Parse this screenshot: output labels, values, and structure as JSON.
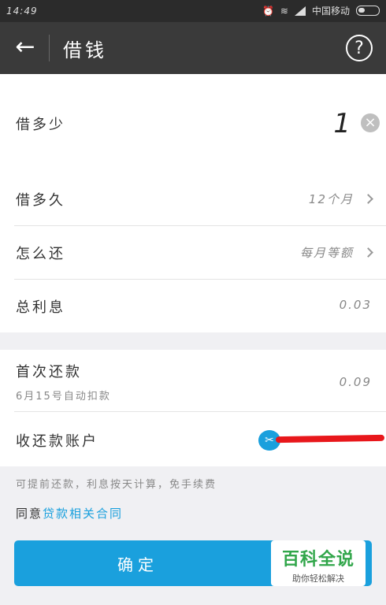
{
  "status_bar": {
    "time": "14:49",
    "carrier": "中国移动"
  },
  "app_bar": {
    "title": "借钱",
    "help": "?"
  },
  "amount_row": {
    "label": "借多少",
    "value": "1"
  },
  "term_row": {
    "label": "借多久",
    "value": "12个月"
  },
  "repay_row": {
    "label": "怎么还",
    "value": "每月等额"
  },
  "interest_row": {
    "label": "总利息",
    "value": "0.03"
  },
  "first_repay_row": {
    "label": "首次还款",
    "sub": "6月15号自动扣款",
    "value": "0.09"
  },
  "account_row": {
    "label": "收还款账户"
  },
  "note": "可提前还款，利息按天计算，免手续费",
  "agree": {
    "prefix": "同意",
    "link": "贷款相关合同"
  },
  "confirm_button": "确定",
  "watermark": {
    "title": "百科全说",
    "subtitle": "助你轻松解决"
  },
  "colors": {
    "accent": "#1aa0dd",
    "redaction": "#e8171b",
    "watermark_green": "#31a64a"
  }
}
